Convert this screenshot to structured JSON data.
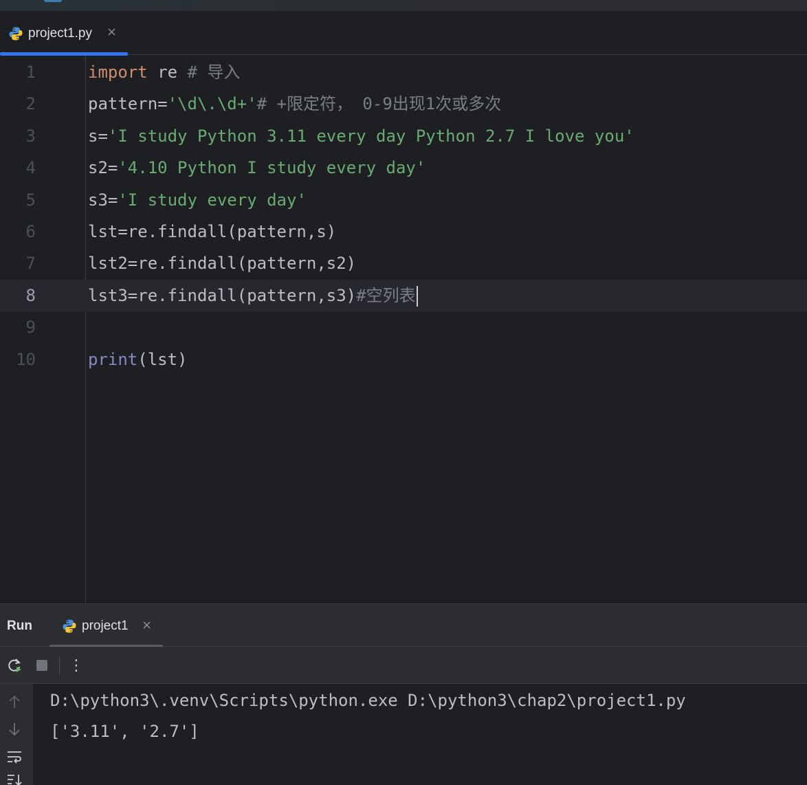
{
  "editor_tab": {
    "filename": "project1.py",
    "close_glyph": "×",
    "icon": "python-icon"
  },
  "editor": {
    "current_line": 8,
    "lines": [
      {
        "number": "1",
        "parts": [
          {
            "t": "import",
            "c": "kw"
          },
          {
            "t": " re ",
            "c": ""
          },
          {
            "t": "# 导入",
            "c": "cmt"
          }
        ]
      },
      {
        "number": "2",
        "parts": [
          {
            "t": "pattern=",
            "c": ""
          },
          {
            "t": "'\\d\\.\\d+'",
            "c": "str"
          },
          {
            "t": "# +限定符， 0-9出现1次或多次",
            "c": "cmt"
          }
        ]
      },
      {
        "number": "3",
        "parts": [
          {
            "t": "s=",
            "c": ""
          },
          {
            "t": "'I study Python 3.11 every day Python 2.7 I love you'",
            "c": "str"
          }
        ]
      },
      {
        "number": "4",
        "parts": [
          {
            "t": "s2=",
            "c": ""
          },
          {
            "t": "'4.10 Python I study every day'",
            "c": "str"
          }
        ]
      },
      {
        "number": "5",
        "parts": [
          {
            "t": "s3=",
            "c": ""
          },
          {
            "t": "'I study every day'",
            "c": "str"
          }
        ]
      },
      {
        "number": "6",
        "parts": [
          {
            "t": "lst=re.findall(pattern,s)",
            "c": ""
          }
        ]
      },
      {
        "number": "7",
        "parts": [
          {
            "t": "lst2=re.findall(pattern,s2)",
            "c": ""
          }
        ]
      },
      {
        "number": "8",
        "parts": [
          {
            "t": "lst3=re.findall(pattern,s3)",
            "c": ""
          },
          {
            "t": "#空列表",
            "c": "cmt"
          }
        ]
      },
      {
        "number": "9",
        "parts": []
      },
      {
        "number": "10",
        "parts": [
          {
            "t": "print",
            "c": "builtin"
          },
          {
            "t": "(lst)",
            "c": ""
          }
        ]
      }
    ]
  },
  "run_panel": {
    "title": "Run",
    "tab_label": "project1",
    "close_glyph": "×",
    "toolbar": {
      "rerun_icon": "rerun-icon",
      "stop_icon": "stop-icon",
      "more_glyph": "⋮"
    },
    "side_icons": [
      "arrow-up-icon",
      "arrow-down-icon",
      "soft-wrap-icon",
      "scroll-to-end-icon"
    ],
    "output": [
      "D:\\python3\\.venv\\Scripts\\python.exe D:\\python3\\chap2\\project1.py",
      "['3.11', '2.7']"
    ]
  },
  "colors": {
    "keyword": "#cf8e6d",
    "string": "#6aab73",
    "comment": "#7a7e85",
    "builtin": "#8888c6",
    "accent": "#3574f0"
  }
}
